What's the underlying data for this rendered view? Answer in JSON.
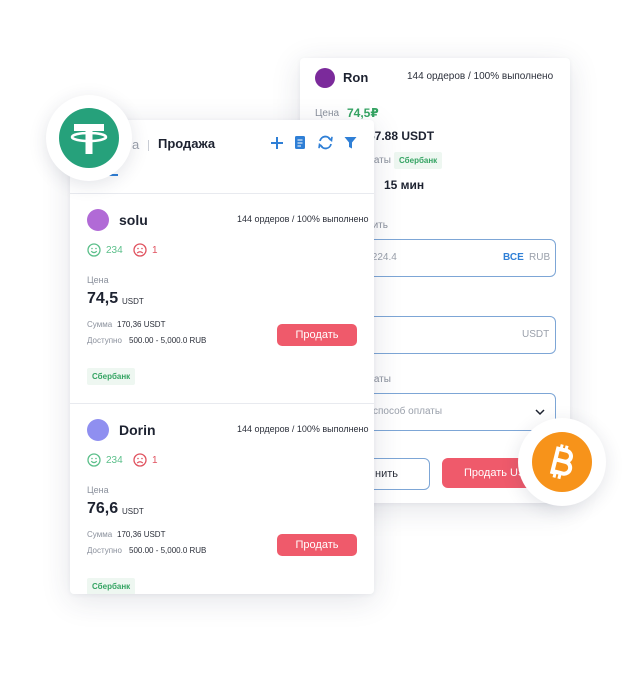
{
  "back_card": {
    "user_name": "Ron",
    "orders": "144 ордеров / 100% выполнено",
    "price_label": "Цена",
    "price_value": "74,5₽",
    "amount_fragment": "57.88 USDT",
    "payment_fragment": "латы",
    "payment_badge": "Сбербанк",
    "time_prefix": "",
    "time_value": "15 мин",
    "pay_label_fragment": "тить",
    "pay_input_fragment": ",224.4",
    "pay_all": "ВСЕ",
    "pay_currency": "RUB",
    "receive_currency": "USDT",
    "method_label_fragment": "латы",
    "method_placeholder_fragment": "способ оплаты",
    "cancel_fragment": "нить",
    "sell_fragment": "Продать USDT"
  },
  "front_card": {
    "header_fragment": "а",
    "header_title": "Продажа",
    "offers": [
      {
        "name": "solu",
        "orders": "144 ордеров / 100% выполнено",
        "likes": "234",
        "dislikes": "1",
        "price_label": "Цена",
        "price": "74,5",
        "price_currency": "USDT",
        "sum_label": "Сумма",
        "sum_value": "170,36 USDT",
        "available_label": "Доступно",
        "available_value": "500.00 - 5,000.0 RUB",
        "sell_label": "Продать",
        "bank": "Сбербанк",
        "avatar_color": "#b16ad6"
      },
      {
        "name": "Dorin",
        "orders": "144 ордеров / 100% выполнено",
        "likes": "234",
        "dislikes": "1",
        "price_label": "Цена",
        "price": "76,6",
        "price_currency": "USDT",
        "sum_label": "Сумма",
        "sum_value": "170,36 USDT",
        "available_label": "Доступно",
        "available_value": "500.00 - 5,000.0 RUB",
        "sell_label": "Продать",
        "bank": "Сбербанк",
        "avatar_color": "#8f8ff0"
      }
    ]
  },
  "colors": {
    "tether": "#26a17b",
    "bitcoin": "#f7931a",
    "accent_blue": "#2f7fd6",
    "sell_red": "#ef5a6b",
    "ron_avatar": "#7b2a9b"
  },
  "icons": [
    "tether-logo-icon",
    "bitcoin-logo-icon",
    "plus-icon",
    "notes-icon",
    "refresh-icon",
    "filter-icon",
    "smile-icon",
    "sad-icon",
    "chevron-down-icon"
  ]
}
